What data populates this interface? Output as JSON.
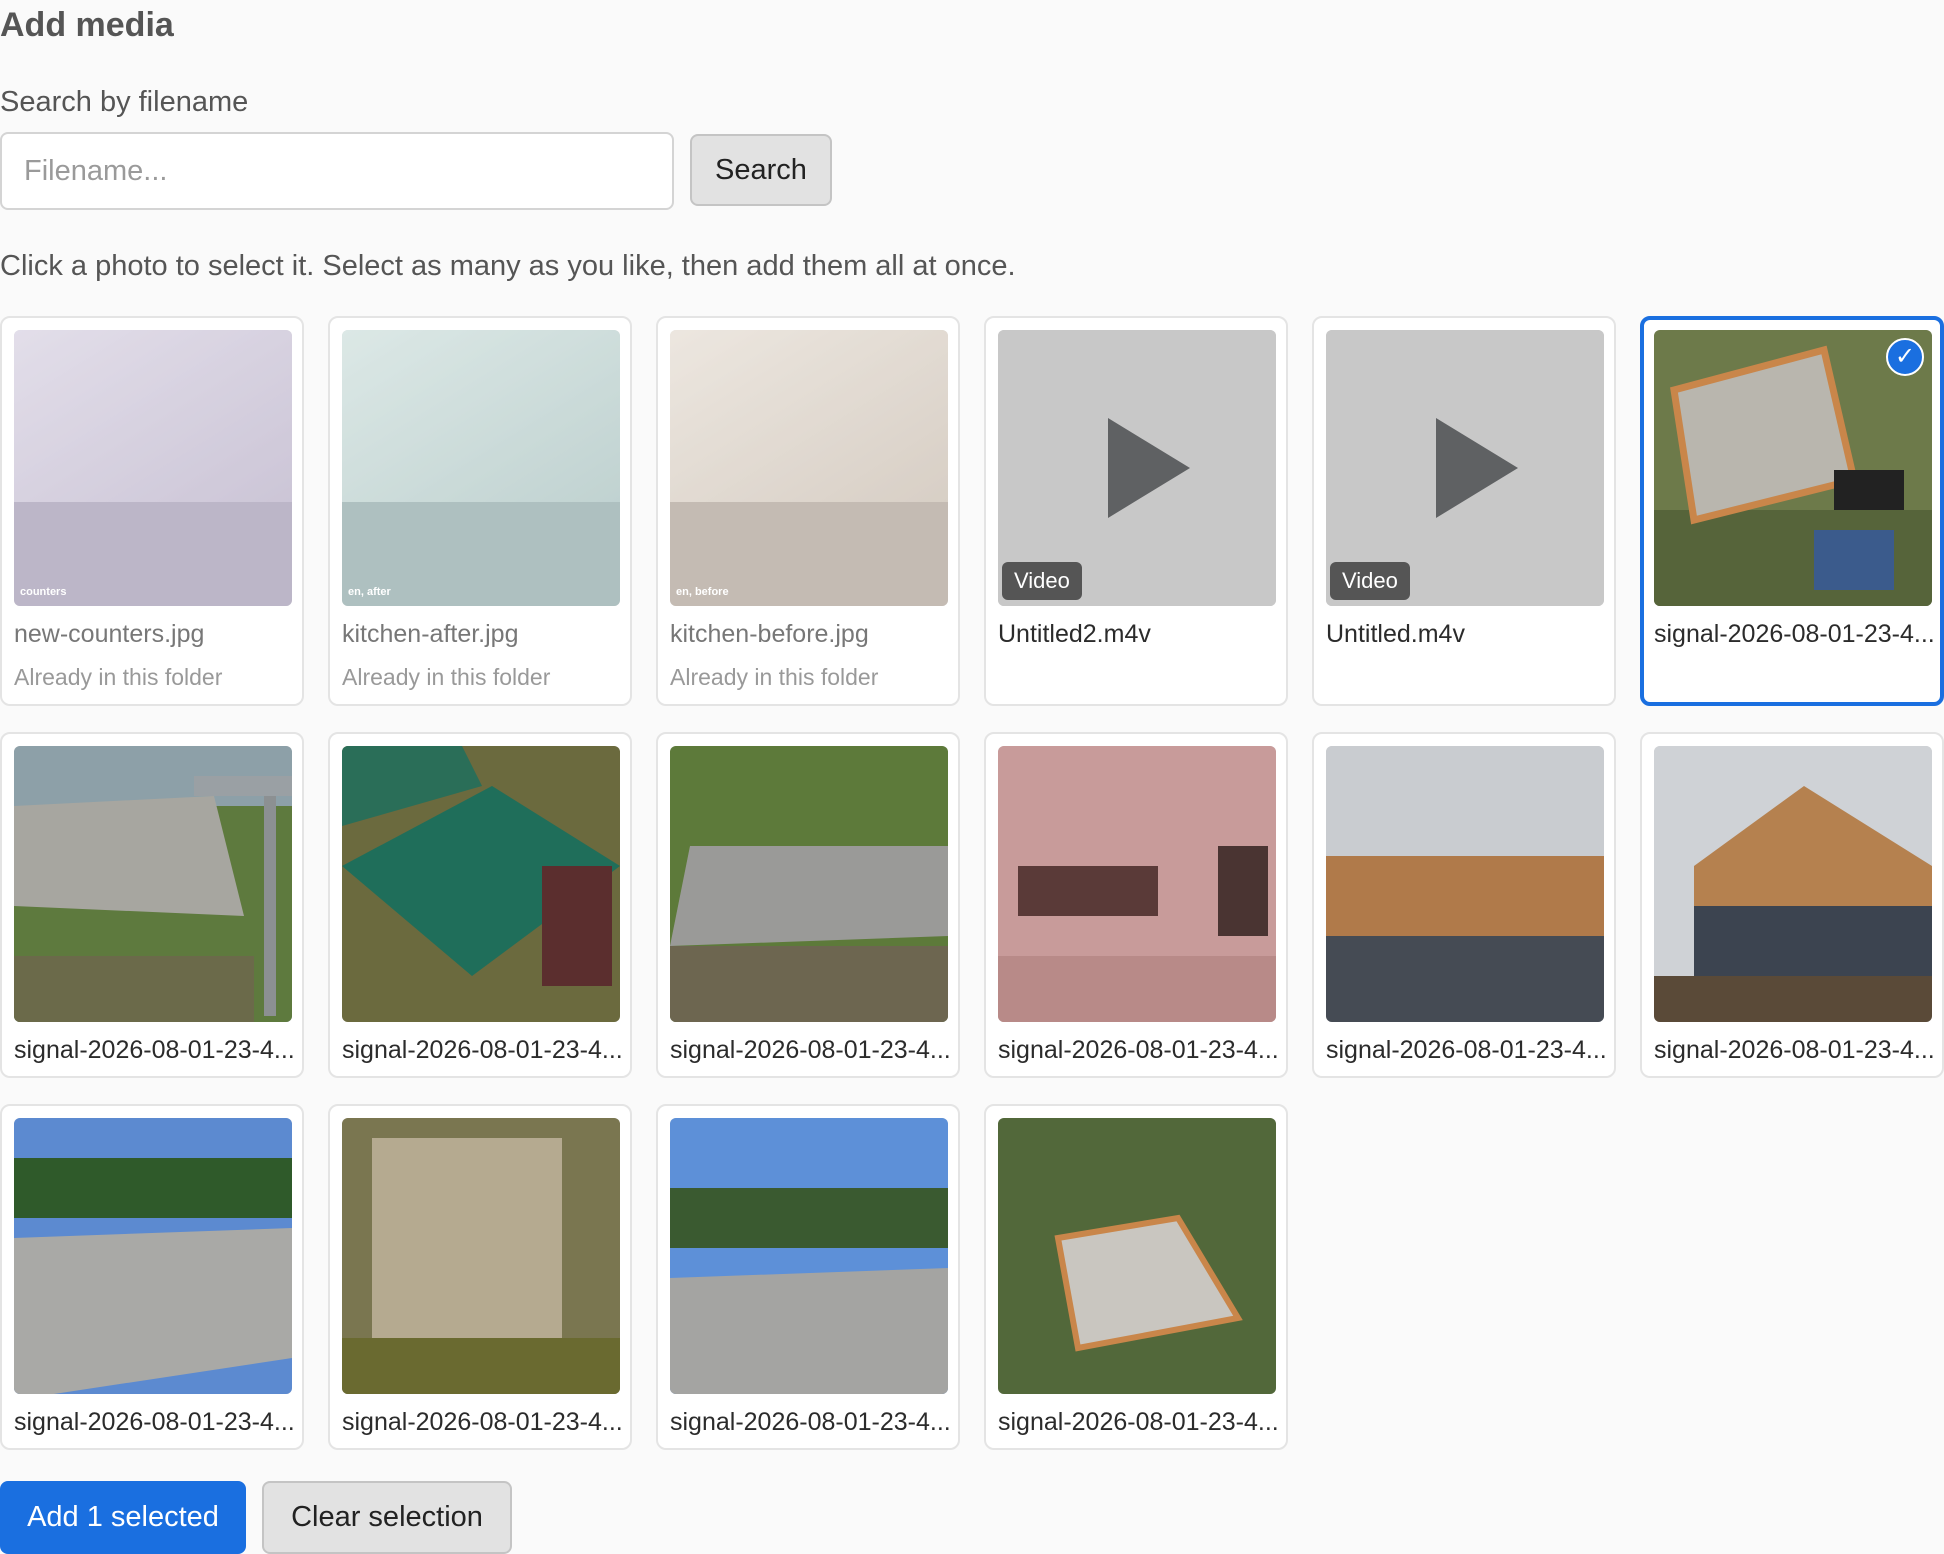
{
  "header": {
    "title": "Add media"
  },
  "search": {
    "label": "Search by filename",
    "placeholder": "Filename...",
    "value": "",
    "button_label": "Search"
  },
  "help_text": "Click a photo to select it. Select as many as you like, then add them all at once.",
  "colors": {
    "accent": "#1a6fe0",
    "selected_border": "#1a6fe0"
  },
  "tiles": [
    {
      "filename": "new-counters.jpg",
      "status": "Already in this folder",
      "thumb_caption": "counters",
      "kind": "photo"
    },
    {
      "filename": "kitchen-after.jpg",
      "status": "Already in this folder",
      "thumb_caption": "en, after",
      "kind": "photo"
    },
    {
      "filename": "kitchen-before.jpg",
      "status": "Already in this folder",
      "thumb_caption": "en, before",
      "kind": "photo"
    },
    {
      "filename": "Untitled2.m4v",
      "badge": "Video",
      "kind": "video"
    },
    {
      "filename": "Untitled.m4v",
      "badge": "Video",
      "kind": "video"
    },
    {
      "filename": "signal-2026-08-01-23-4...",
      "kind": "photo",
      "selected": true
    },
    {
      "filename": "signal-2026-08-01-23-4...",
      "kind": "photo"
    },
    {
      "filename": "signal-2026-08-01-23-4...",
      "kind": "photo"
    },
    {
      "filename": "signal-2026-08-01-23-4...",
      "kind": "photo"
    },
    {
      "filename": "signal-2026-08-01-23-4...",
      "kind": "photo"
    },
    {
      "filename": "signal-2026-08-01-23-4...",
      "kind": "photo"
    },
    {
      "filename": "signal-2026-08-01-23-4...",
      "kind": "photo"
    },
    {
      "filename": "signal-2026-08-01-23-4...",
      "kind": "photo"
    },
    {
      "filename": "signal-2026-08-01-23-4...",
      "kind": "photo"
    },
    {
      "filename": "signal-2026-08-01-23-4...",
      "kind": "photo"
    },
    {
      "filename": "signal-2026-08-01-23-4...",
      "kind": "photo"
    }
  ],
  "selection": {
    "check_icon": "✓"
  },
  "actions": {
    "add_label": "Add 1 selected",
    "clear_label": "Clear selection"
  }
}
